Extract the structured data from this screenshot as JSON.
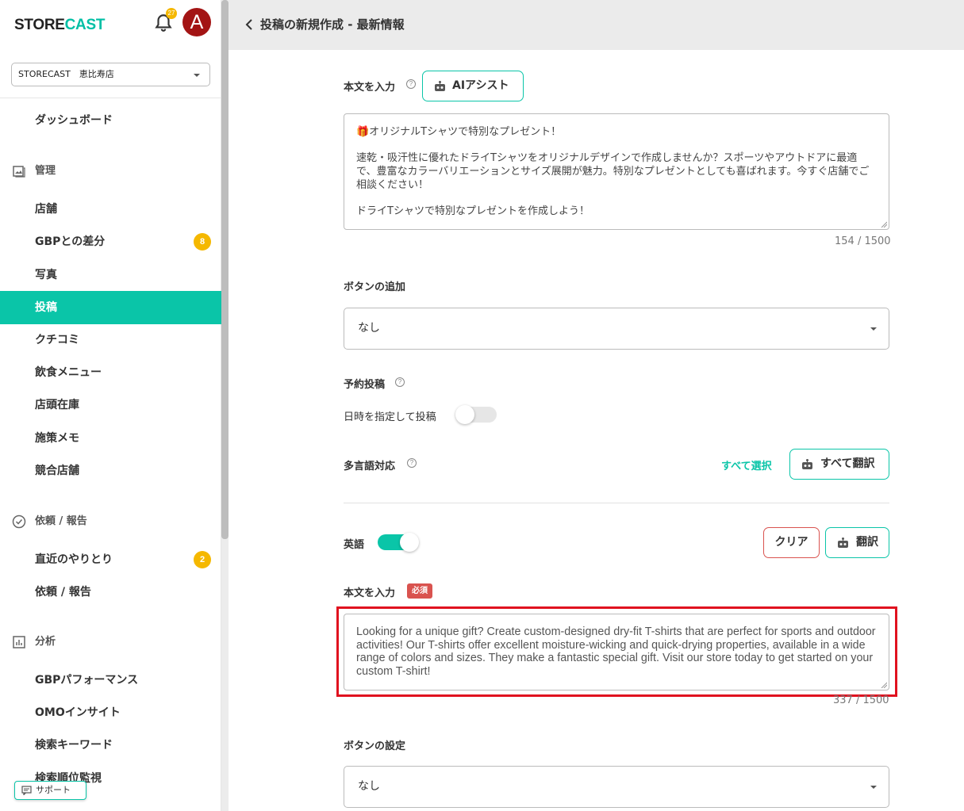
{
  "sidebar": {
    "logo_store": "STORE",
    "logo_cast": "CAST",
    "notification_count": "27",
    "avatar_letter": "A",
    "store_select": "STORECAST　恵比寿店",
    "items": {
      "dashboard": "ダッシュボード",
      "section_manage": "管理",
      "store": "店舗",
      "gbp_diff": "GBPとの差分",
      "gbp_diff_badge": "8",
      "photos": "写真",
      "posts": "投稿",
      "reviews": "クチコミ",
      "menu": "飲食メニュー",
      "inventory": "店頭在庫",
      "memo": "施策メモ",
      "competitors": "競合店舗",
      "section_requests": "依頼 / 報告",
      "recent": "直近のやりとり",
      "recent_badge": "2",
      "requests": "依頼 / 報告",
      "section_analysis": "分析",
      "gbp_perf": "GBPパフォーマンス",
      "omo": "OMOインサイト",
      "keywords": "検索キーワード",
      "ranking": "検索順位監視"
    },
    "support": "サポート"
  },
  "header": {
    "title": "投稿の新規作成 - 最新情報"
  },
  "form": {
    "body_label": "本文を入力",
    "ai_assist": "AIアシスト",
    "body_text_line1": "🎁オリジナルTシャツで特別なプレゼント！",
    "body_text_line2": "速乾・吸汗性に優れたドライTシャツをオリジナルデザインで作成しませんか？スポーツやアウトドアに最適で、豊富なカラーバリエーションとサイズ展開が魅力。特別なプレゼントとしても喜ばれます。今すぐ店舗でご相談ください！",
    "body_text_line3": "ドライTシャツで特別なプレゼントを作成しよう！",
    "body_counter": "154 / 1500",
    "button_add_label": "ボタンの追加",
    "button_add_value": "なし",
    "schedule_label": "予約投稿",
    "schedule_toggle_label": "日時を指定して投稿",
    "multilang_label": "多言語対応",
    "select_all": "すべて選択",
    "translate_all": "すべて翻訳",
    "english_label": "英語",
    "clear": "クリア",
    "translate": "翻訳",
    "en_body_label": "本文を入力",
    "required": "必須",
    "en_body_text": "Looking for a unique gift? Create custom-designed dry-fit T-shirts that are perfect for sports and outdoor activities! Our T-shirts offer excellent moisture-wicking and quick-drying properties, available in a wide range of colors and sizes. They make a fantastic special gift. Visit our store today to get started on your custom T-shirt!",
    "en_counter": "337 / 1500",
    "button_setting_label": "ボタンの設定",
    "button_setting_value": "なし"
  },
  "colors": {
    "accent": "#0ac5a8",
    "danger": "#d9534f",
    "highlight": "#e0121f",
    "badge": "#f5b800"
  }
}
